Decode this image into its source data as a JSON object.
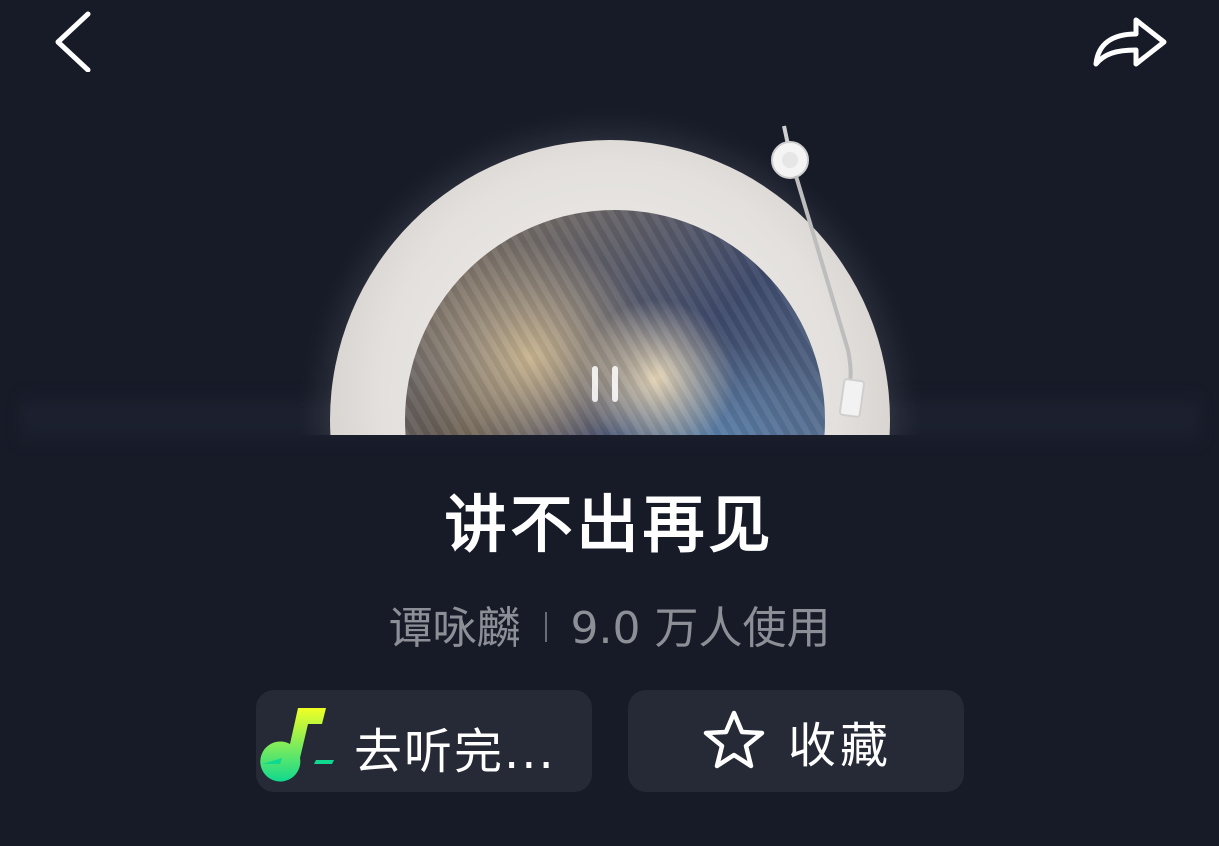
{
  "colors": {
    "background": "#171b28",
    "button_background": "#262a36",
    "title_text": "#ffffff",
    "meta_text": "#8d8f96",
    "app_icon_yellow": "#e9ff2a",
    "app_icon_green": "#1ed98a"
  },
  "topbar": {
    "back_icon": "chevron-left-icon",
    "share_icon": "share-arrow-icon"
  },
  "player": {
    "state": "playing",
    "control_icon": "pause-icon"
  },
  "song": {
    "title": "讲不出再见",
    "artist": "谭咏麟",
    "usage": "9.0 万人使用"
  },
  "actions": {
    "listen_label": "去听完...",
    "listen_icon": "music-app-icon",
    "favorite_label": "收藏",
    "favorite_icon": "star-icon"
  }
}
